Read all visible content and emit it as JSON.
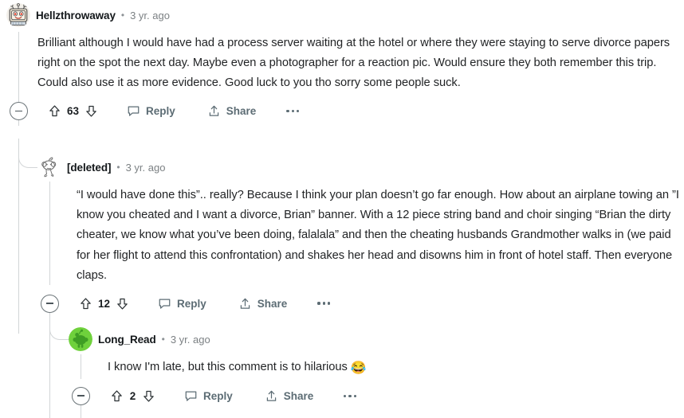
{
  "page": {
    "site": "reddit-comment-thread",
    "colors": {
      "background": "#ffffff",
      "body_text": "#222426",
      "username": "#13171a",
      "timestamp": "#7c8184",
      "action_label": "#5c6c74",
      "thread_line": "#d2d5d7",
      "avatar_green": "#6fd13c"
    }
  },
  "actions": {
    "collapse_label": "collapse",
    "upvote_label": "upvote",
    "downvote_label": "downvote",
    "reply_label": "Reply",
    "share_label": "Share",
    "more_label": "more options"
  },
  "comments": [
    {
      "id": "c1",
      "depth": 0,
      "username": "Hellzthrowaway",
      "separator": "•",
      "timestamp": "3 yr. ago",
      "avatar": "tv-head-snoo-avatar",
      "body": "Brilliant although I would have had a process server waiting at the hotel or where they were staying to serve divorce papers right on the spot the next day. Maybe even a photographer for a reaction pic. Would ensure they both remember this trip. Could also use it as more evidence. Good luck to you tho sorry some people suck.",
      "score": "63",
      "reply_label": "Reply",
      "share_label": "Share"
    },
    {
      "id": "c2",
      "depth": 1,
      "username": "[deleted]",
      "separator": "•",
      "timestamp": "3 yr. ago",
      "avatar": "deleted-outline-snoo-avatar",
      "body": "“I would have done this”.. really? Because I think your plan doesn’t go far enough. How about an airplane towing an ”I know you cheated and I want a divorce, Brian” banner. With a 12 piece string band and choir singing “Brian the dirty cheater, we know what you’ve been doing, falalala” and then the cheating husbands Grandmother walks in (we paid for her flight to attend this confrontation) and shakes her head and disowns him in front of hotel staff. Then everyone claps.",
      "score": "12",
      "reply_label": "Reply",
      "share_label": "Share"
    },
    {
      "id": "c3",
      "depth": 2,
      "username": "Long_Read",
      "separator": "•",
      "timestamp": "3 yr. ago",
      "avatar": "green-snoo-avatar",
      "body": "I know I'm late, but this comment is to hilarious ",
      "body_emoji": "😂",
      "score": "2",
      "reply_label": "Reply",
      "share_label": "Share"
    }
  ]
}
